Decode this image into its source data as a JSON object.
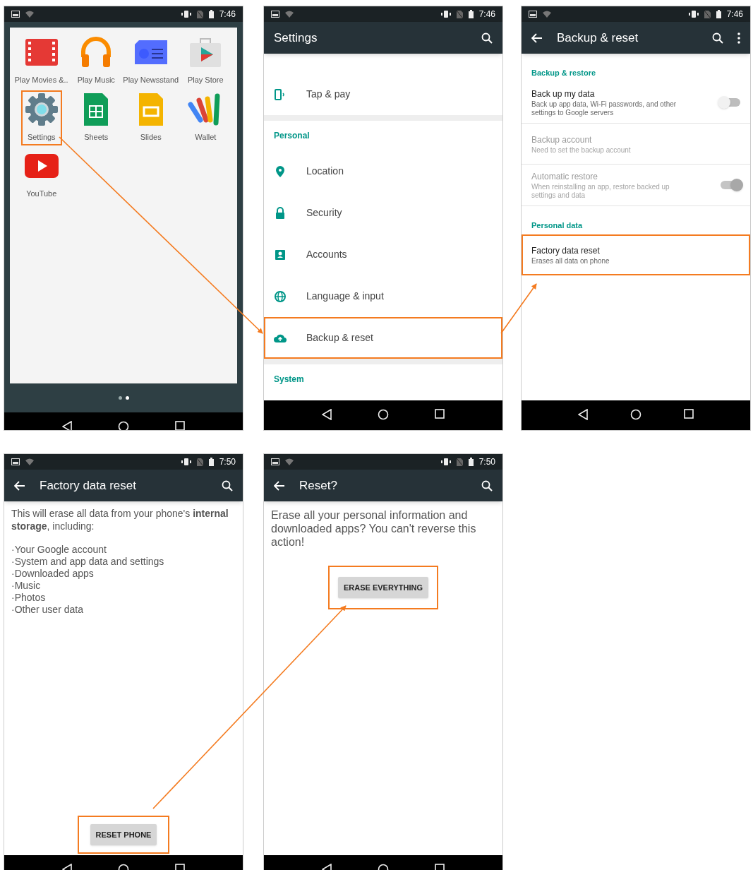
{
  "screens": [
    {
      "kind": "home",
      "time": "7:46",
      "apps": [
        {
          "label": "Play Movies &..",
          "highlighted": false
        },
        {
          "label": "Play Music",
          "highlighted": false
        },
        {
          "label": "Play Newsstand",
          "highlighted": false
        },
        {
          "label": "Play Store",
          "highlighted": false
        },
        {
          "label": "Settings",
          "highlighted": true
        },
        {
          "label": "Sheets",
          "highlighted": false
        },
        {
          "label": "Slides",
          "highlighted": false
        },
        {
          "label": "Wallet",
          "highlighted": false
        },
        {
          "label": "YouTube",
          "highlighted": false
        }
      ],
      "page_dots": [
        {
          "selected": false
        },
        {
          "selected": true
        }
      ]
    },
    {
      "kind": "settings",
      "time": "7:46",
      "title": "Settings",
      "items": [
        {
          "kind": "item",
          "label": "Tap & pay",
          "highlighted": false
        },
        {
          "kind": "header",
          "label": "Personal"
        },
        {
          "kind": "item",
          "label": "Location",
          "highlighted": false
        },
        {
          "kind": "item",
          "label": "Security",
          "highlighted": false
        },
        {
          "kind": "item",
          "label": "Accounts",
          "highlighted": false
        },
        {
          "kind": "item",
          "label": "Language & input",
          "highlighted": false
        },
        {
          "kind": "item",
          "label": "Backup & reset",
          "highlighted": true
        },
        {
          "kind": "header",
          "label": "System"
        }
      ]
    },
    {
      "kind": "backup",
      "time": "7:46",
      "title": "Backup & reset",
      "items": [
        {
          "kind": "header",
          "label": "Backup & restore"
        },
        {
          "kind": "item",
          "title": "Back up my data",
          "summary": "Back up app data, Wi-Fi passwords, and other settings to Google servers",
          "disabled": false,
          "toggle": true,
          "on": false,
          "highlighted": false
        },
        {
          "kind": "item",
          "title": "Backup account",
          "summary": "Need to set the backup account",
          "disabled": true,
          "toggle": false,
          "highlighted": false
        },
        {
          "kind": "item",
          "title": "Automatic restore",
          "summary": "When reinstalling an app, restore backed up settings and data",
          "disabled": true,
          "toggle": true,
          "on": true,
          "highlighted": false
        },
        {
          "kind": "header",
          "label": "Personal data"
        },
        {
          "kind": "item",
          "title": "Factory data reset",
          "summary": "Erases all data on phone",
          "disabled": false,
          "toggle": false,
          "highlighted": true
        }
      ]
    },
    {
      "kind": "factory",
      "time": "7:50",
      "title": "Factory data reset",
      "intro": "This will erase all data from your phone's **internal storage**, including:",
      "list": [
        "·Your Google account",
        "·System and app data and settings",
        "·Downloaded apps",
        "·Music",
        "·Photos",
        "·Other user data"
      ],
      "button": {
        "label": "RESET PHONE",
        "highlighted": true
      }
    },
    {
      "kind": "confirm",
      "time": "7:50",
      "title": "Reset?",
      "message": "Erase all your personal information and downloaded apps? You can't reverse this action!",
      "button": {
        "label": "ERASE EVERYTHING",
        "highlighted": true
      }
    }
  ]
}
